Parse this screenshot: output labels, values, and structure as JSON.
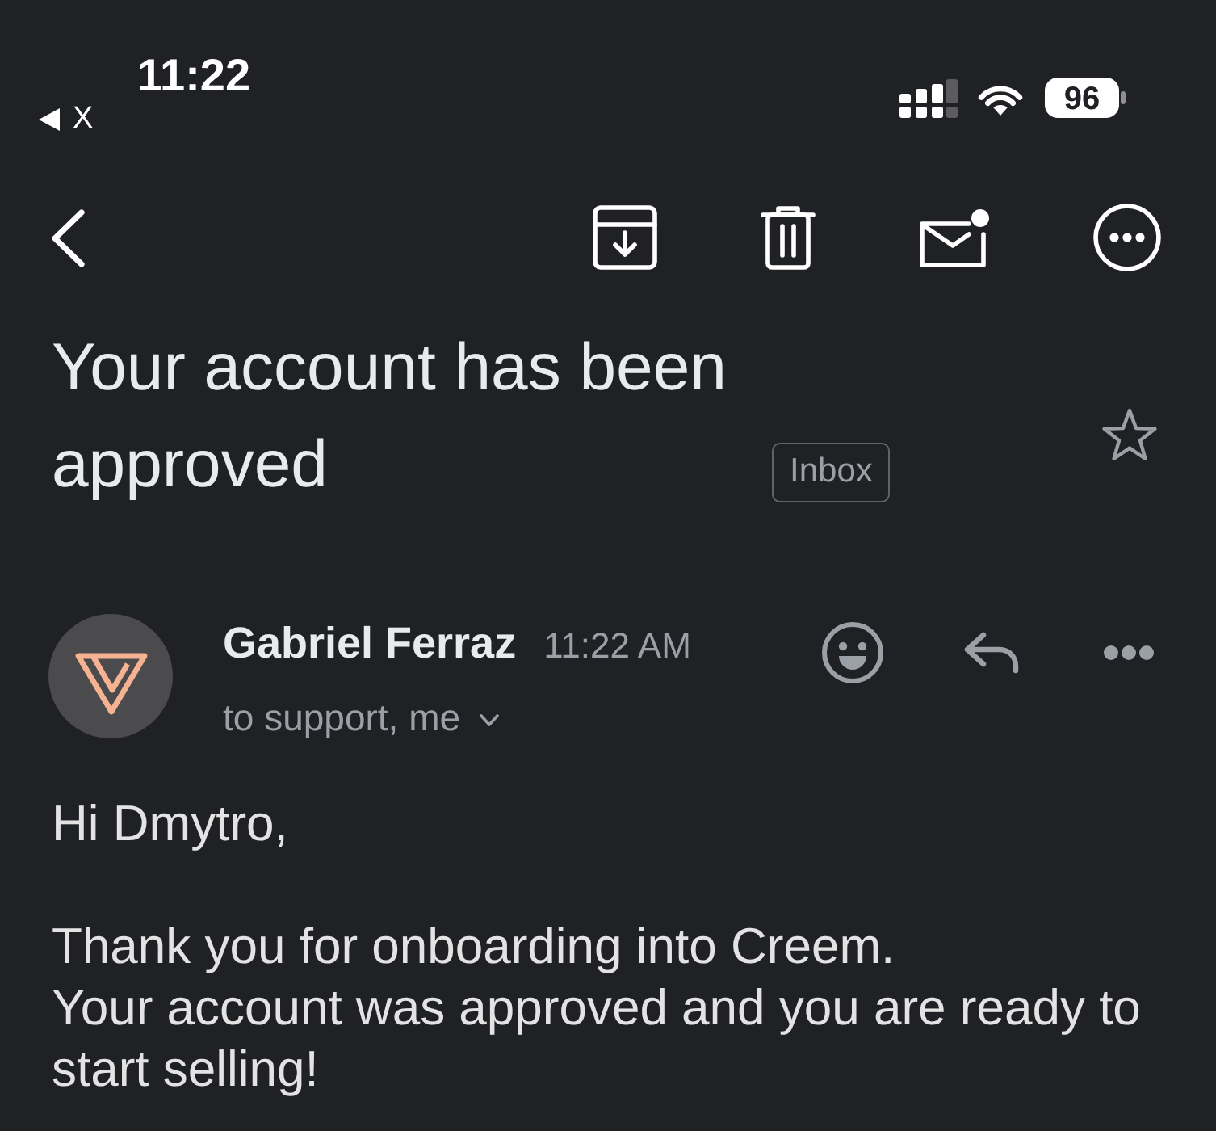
{
  "status_bar": {
    "time": "11:22",
    "back_to_app": "X",
    "battery": "96"
  },
  "subject": {
    "title": "Your account has been approved",
    "label": "Inbox",
    "starred": false
  },
  "message": {
    "sender": "Gabriel Ferraz",
    "time": "11:22 AM",
    "recipients": "to support, me",
    "paragraphs": [
      {
        "lines": [
          "Hi Dmytro,"
        ]
      },
      {
        "lines": [
          "Thank you for onboarding into Creem.",
          "Your account was approved and you are ready to start selling!"
        ]
      }
    ]
  }
}
